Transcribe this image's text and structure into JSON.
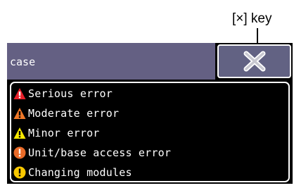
{
  "callout": {
    "text": "[×] key"
  },
  "header": {
    "title": "case"
  },
  "close_button": {
    "icon": "close-x-icon"
  },
  "legend": {
    "items": [
      {
        "label": "Serious error",
        "icon": "serious-error-icon",
        "color": "#e8202a"
      },
      {
        "label": "Moderate error",
        "icon": "moderate-error-icon",
        "color": "#f07828"
      },
      {
        "label": "Minor error",
        "icon": "minor-error-icon",
        "color": "#f8e800"
      },
      {
        "label": "Unit/base access error",
        "icon": "unit-base-access-error-icon",
        "color": "#e86a28"
      },
      {
        "label": "Changing modules",
        "icon": "changing-modules-icon",
        "color": "#f8c800"
      }
    ]
  },
  "colors": {
    "header_bg": "#646083",
    "panel_bg": "#000000",
    "text": "#ffffff"
  }
}
